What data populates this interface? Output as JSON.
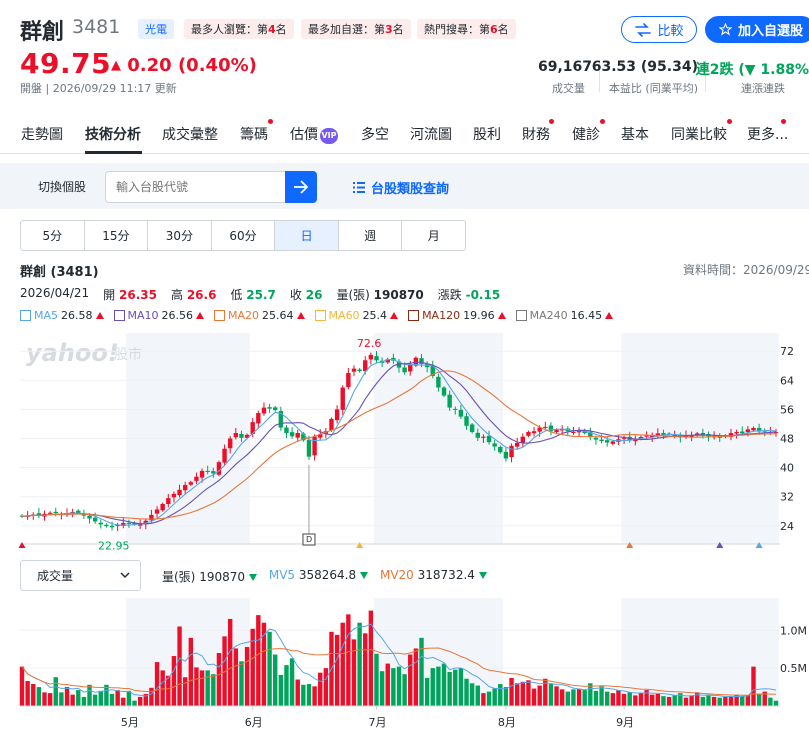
{
  "header": {
    "name": "群創",
    "code": "3481",
    "sector": "光電",
    "ranks": [
      {
        "label": "最多人瀏覽：第",
        "num": "4",
        "suffix": "名"
      },
      {
        "label": "最多加自選：第",
        "num": "3",
        "suffix": "名"
      },
      {
        "label": "熱門搜尋：第",
        "num": "6",
        "suffix": "名"
      }
    ],
    "compare_label": "比較",
    "watch_label": "加入自選股",
    "price": "49.75",
    "change": "0.20 (0.40%)",
    "status": "開盤 | 2026/09/29 11:17 更新",
    "stats": [
      {
        "value": "69,167",
        "label": "成交量"
      },
      {
        "value": "63.53 (95.34)",
        "label": "本益比 (同業平均)"
      },
      {
        "prefix": "連2跌",
        "value": "1.88%",
        "label": "連漲連跌"
      }
    ]
  },
  "tabs": [
    {
      "label": "走勢圖"
    },
    {
      "label": "技術分析"
    },
    {
      "label": "成交彙整"
    },
    {
      "label": "籌碼"
    },
    {
      "label": "估價"
    },
    {
      "label": "多空"
    },
    {
      "label": "河流圖"
    },
    {
      "label": "股利"
    },
    {
      "label": "財務"
    },
    {
      "label": "健診"
    },
    {
      "label": "基本"
    },
    {
      "label": "同業比較"
    },
    {
      "label": "更多..."
    }
  ],
  "vip_label": "VIP",
  "search": {
    "label": "切換個股",
    "placeholder": "輸入台股代號",
    "category_link": "台股類股查詢"
  },
  "periods": [
    "5分",
    "15分",
    "30分",
    "60分",
    "日",
    "週",
    "月"
  ],
  "chart_title": "群創 (3481)",
  "data_time": "資料時間：2026/09/29",
  "ohlc": {
    "date": "2026/04/21",
    "open_label": "開",
    "open": "26.35",
    "high_label": "高",
    "high": "26.6",
    "low_label": "低",
    "low": "25.7",
    "close_label": "收",
    "close": "26",
    "vol_label": "量(張)",
    "vol": "190870",
    "chg_label": "漲跌",
    "chg": "-0.15"
  },
  "ma_legend": [
    {
      "name": "MA5",
      "value": "26.58",
      "color": "#58a6e8"
    },
    {
      "name": "MA10",
      "value": "26.56",
      "color": "#6a4fb5"
    },
    {
      "name": "MA20",
      "value": "25.64",
      "color": "#e8773a"
    },
    {
      "name": "MA60",
      "value": "25.4",
      "color": "#f2b63c"
    },
    {
      "name": "MA120",
      "value": "19.96",
      "color": "#8b2b14"
    },
    {
      "name": "MA240",
      "value": "16.45",
      "color": "#7a7a7a"
    }
  ],
  "watermark": {
    "brand": "yahoo!",
    "suffix": "股市"
  },
  "volume": {
    "select_label": "成交量",
    "vol_label": "量(張)",
    "vol": "190870",
    "mv5_label": "MV5",
    "mv5": "358264.8",
    "mv20_label": "MV20",
    "mv20": "318732.4"
  },
  "colors": {
    "up": "#eb0f29",
    "down": "#00a55b",
    "accent": "#0f69ff",
    "ma5": "#58a6e8",
    "ma10": "#6a4fb5",
    "ma20": "#e8773a"
  },
  "chart_data": {
    "type": "candlestick",
    "price_axis": {
      "ticks": [
        "72",
        "64",
        "56",
        "48",
        "40",
        "32",
        "24"
      ],
      "ylim": [
        19,
        77
      ]
    },
    "volume_axis": {
      "ticks": [
        "1.0M",
        "0.5M"
      ],
      "ylim": [
        0,
        1400000
      ]
    },
    "month_labels": [
      "5月",
      "6月",
      "7月",
      "8月",
      "9月"
    ],
    "annotations": {
      "max_label": "72.6",
      "min_label": "22.95",
      "marker_label": "D"
    },
    "closes": [
      26.6,
      26.9,
      27.1,
      26.8,
      27.3,
      27.6,
      27.5,
      27.2,
      27.4,
      27.8,
      27.5,
      26.8,
      26.0,
      25.2,
      24.4,
      23.9,
      23.6,
      24.2,
      24.8,
      24.6,
      24.4,
      24.6,
      25.4,
      27.0,
      28.5,
      30.0,
      31.6,
      32.8,
      33.9,
      35.2,
      36.0,
      37.5,
      39.1,
      38.8,
      38.4,
      41.5,
      45.2,
      48.0,
      49.5,
      48.2,
      49.0,
      52.5,
      55.0,
      56.5,
      56.2,
      55.8,
      51.0,
      49.5,
      48.6,
      49.5,
      47.5,
      43.0,
      48.5,
      49.2,
      50.0,
      53.4,
      56.0,
      62.0,
      66.0,
      67.2,
      66.5,
      69.5,
      71.0,
      69.5,
      68.8,
      69.8,
      69.4,
      67.5,
      66.2,
      68.4,
      70.2,
      68.5,
      67.6,
      65.2,
      62.0,
      59.8,
      56.5,
      56.0,
      54.0,
      51.5,
      49.8,
      48.2,
      48.5,
      47.0,
      45.8,
      44.2,
      42.5,
      46.0,
      46.8,
      48.5,
      49.8,
      50.0,
      51.0,
      51.2,
      50.0,
      50.4,
      50.5,
      50.0,
      49.8,
      50.2,
      49.5,
      48.4,
      47.7,
      47.3,
      46.9,
      47.2,
      47.8,
      48.1,
      47.5,
      47.9,
      48.4,
      48.8,
      49.0,
      49.4,
      49.0,
      49.2,
      49.0,
      48.3,
      48.8,
      49.0,
      49.4,
      48.9,
      48.6,
      48.6,
      48.2,
      48.8,
      49.5,
      49.8,
      49.4,
      50.5,
      50.9,
      49.9,
      50.0,
      49.8,
      49.75
    ],
    "volumes": [
      520000,
      330000,
      290000,
      250000,
      180000,
      170000,
      380000,
      180000,
      250000,
      150000,
      210000,
      120000,
      280000,
      150000,
      200000,
      280000,
      160000,
      210000,
      110000,
      200000,
      70000,
      120000,
      160000,
      240000,
      580000,
      470000,
      400000,
      660000,
      1050000,
      380000,
      900000,
      510000,
      470000,
      470000,
      420000,
      700000,
      920000,
      1150000,
      760000,
      590000,
      780000,
      1020000,
      1200000,
      1100000,
      980000,
      680000,
      410000,
      540000,
      630000,
      350000,
      280000,
      290000,
      260000,
      440000,
      500000,
      980000,
      940000,
      1100000,
      1210000,
      880000,
      1100000,
      960000,
      1260000,
      690000,
      460000,
      560000,
      500000,
      520000,
      420000,
      680000,
      760000,
      900000,
      370000,
      500000,
      520000,
      560000,
      450000,
      480000,
      500000,
      360000,
      300000,
      270000,
      170000,
      190000,
      230000,
      290000,
      250000,
      370000,
      300000,
      320000,
      340000,
      230000,
      270000,
      360000,
      290000,
      260000,
      220000,
      190000,
      220000,
      230000,
      210000,
      300000,
      200000,
      260000,
      190000,
      170000,
      210000,
      160000,
      180000,
      140000,
      170000,
      210000,
      150000,
      160000,
      130000,
      120000,
      140000,
      170000,
      110000,
      140000,
      180000,
      120000,
      150000,
      120000,
      110000,
      120000,
      130000,
      150000,
      130000,
      140000,
      520000,
      160000,
      190000,
      110000,
      69167
    ]
  }
}
